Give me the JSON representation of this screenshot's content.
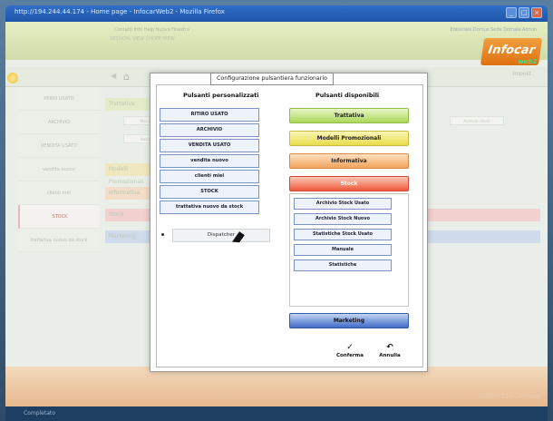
{
  "window": {
    "title": "http://194.244.44.174 - Home page - InfocarWeb2 - Mozilla Firefox",
    "buttons": [
      "_",
      "□",
      "×"
    ]
  },
  "app": {
    "toolbar_links": "Contatti   Info   Help   Nuova Finestra",
    "session": "SESSION: VIEW CHOPE VIEW",
    "top_links": "Editoriale Domus  Sede Domale  Admin",
    "logo_text": "Infocar",
    "logo_sub": "web2",
    "top_right": "Impost"
  },
  "sidebar": {
    "items": [
      {
        "label": "PERIO USATO"
      },
      {
        "label": "ARCHIVIO"
      },
      {
        "label": "VENDITA USATO"
      },
      {
        "label": "vendita nuovo"
      },
      {
        "label": "clienti mei"
      },
      {
        "label": "STOCK"
      },
      {
        "label": "trattativa nuovo da stock"
      }
    ]
  },
  "background": {
    "rows": [
      "Trattativa",
      "Modelli Promozionali",
      "Informativa",
      "Stock",
      "Marketing"
    ],
    "btns": [
      "Mes la",
      "Nessu",
      "Archivio clienti"
    ],
    "brand": "EditorialeDomus"
  },
  "statusbar": {
    "text": "Completato"
  },
  "dialog": {
    "tab_title": "Configurazione pulsantiera funzionario",
    "left_title": "Pulsanti personalizzati",
    "right_title": "Pulsanti disponibili",
    "personalizzati": [
      "RITIRO USATO",
      "ARCHIVIO",
      "VENDITA USATO",
      "vendita nuovo",
      "clienti miei",
      "STOCK",
      "trattativa nuovo da stock"
    ],
    "dispatcher": "Dispatcher",
    "categories": {
      "trattativa": "Trattativa",
      "modelli": "Modelli Promozionali",
      "informativa": "Informativa",
      "stock": "Stock",
      "marketing": "Marketing"
    },
    "stock_items": [
      "Archivio Stock Usato",
      "Archivio Stock Nuovo",
      "Statistiche Stock Usato",
      "Manuale",
      "Statistiche"
    ],
    "confirm_label": "Conferma",
    "cancel_label": "Annulla"
  }
}
